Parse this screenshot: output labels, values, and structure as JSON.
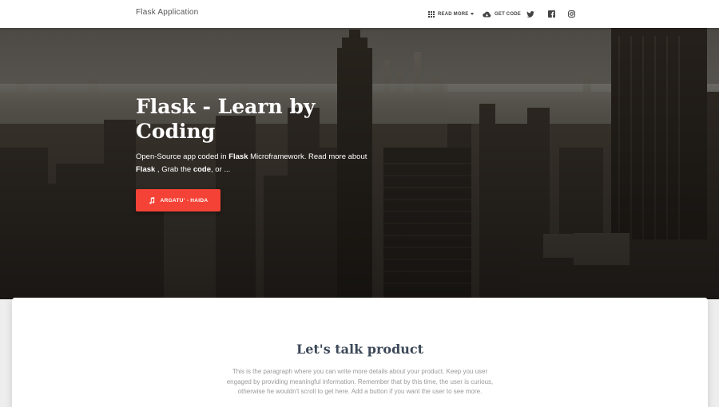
{
  "navbar": {
    "brand": "Flask Application",
    "read_more": "READ MORE",
    "get_code": "GET CODE",
    "icons": [
      "apps-icon",
      "cloud-download-icon",
      "twitter-icon",
      "facebook-icon",
      "instagram-icon"
    ]
  },
  "hero": {
    "title": "Flask - Learn by Coding",
    "desc_1": "Open-Source app coded in ",
    "desc_flask": "Flask",
    "desc_2": " Microframework. Read more about ",
    "desc_flask2": "Flask",
    "desc_3": " , Grab the ",
    "desc_code": "code",
    "desc_4": ", or ...",
    "button_label": "ARGATU' - HAIDA",
    "button_color": "#f44336"
  },
  "section": {
    "title": "Let's talk product",
    "text": "This is the paragraph where you can write more details about your product. Keep you user engaged by providing meaningful information. Remember that by this time, the user is curious, otherwise he wouldn't scroll to get here. Add a button if you want the user to see more."
  }
}
